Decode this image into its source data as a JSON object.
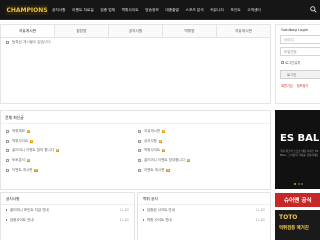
{
  "header": {
    "logo_text": "CHAMPIONS",
    "nav": [
      "공지사항",
      "이벤트 자료실",
      "검증 업체",
      "먹튀사이트",
      "방송정보",
      "대충출발",
      "스포츠 분석",
      "커뮤니티",
      "포인트",
      "고객센터"
    ]
  },
  "board": {
    "tabs": [
      "자유게시판",
      "잡담방",
      "공지사항",
      "먹튀방",
      "자유게시판"
    ],
    "empty_message": "등록된 게시물이 없습니다."
  },
  "login": {
    "title": "Goldbag Login",
    "id_placeholder": "아이디",
    "pw_placeholder": "비밀번호",
    "remember": "로그인유지",
    "login_button": "로그인",
    "links": [
      "회원가입",
      "정보찾기"
    ]
  },
  "recent": {
    "title": "전체 최신글",
    "left": [
      "먹튀제보",
      "먹튀사이트",
      "골드머니 이벤트 참여 합니다",
      "토토분석",
      "이벤트 게시판"
    ],
    "right": [
      "자유게시판",
      "공지사항",
      "먹튀사이트",
      "골드머니 이벤트 참여합니다",
      "이벤트 게시판"
    ],
    "new_badge": "N"
  },
  "banner": {
    "head": "",
    "title": "ES BALL",
    "text": "국내 최고의 스포츠 베팅 사이트 ES BALL 그 이상의 가치를 경험하세요"
  },
  "bottom_left": {
    "title": "공지사항",
    "rows": [
      {
        "text": "골드머니 포인트 지급 안내",
        "date": "11-02"
      },
      {
        "text": "검증사이트 안내",
        "date": "11-02"
      }
    ]
  },
  "bottom_right": {
    "title": "먹튀 공지",
    "rows": [
      {
        "text": "검증된 사이트 안내",
        "date": "11-02"
      },
      {
        "text": "먹튀 사이트 안내",
        "date": "11-02"
      }
    ]
  },
  "ads": {
    "red_text": "슈어맨 공식",
    "dark_title": "TOTO",
    "dark_sub": "먹튀검증 매거진"
  }
}
